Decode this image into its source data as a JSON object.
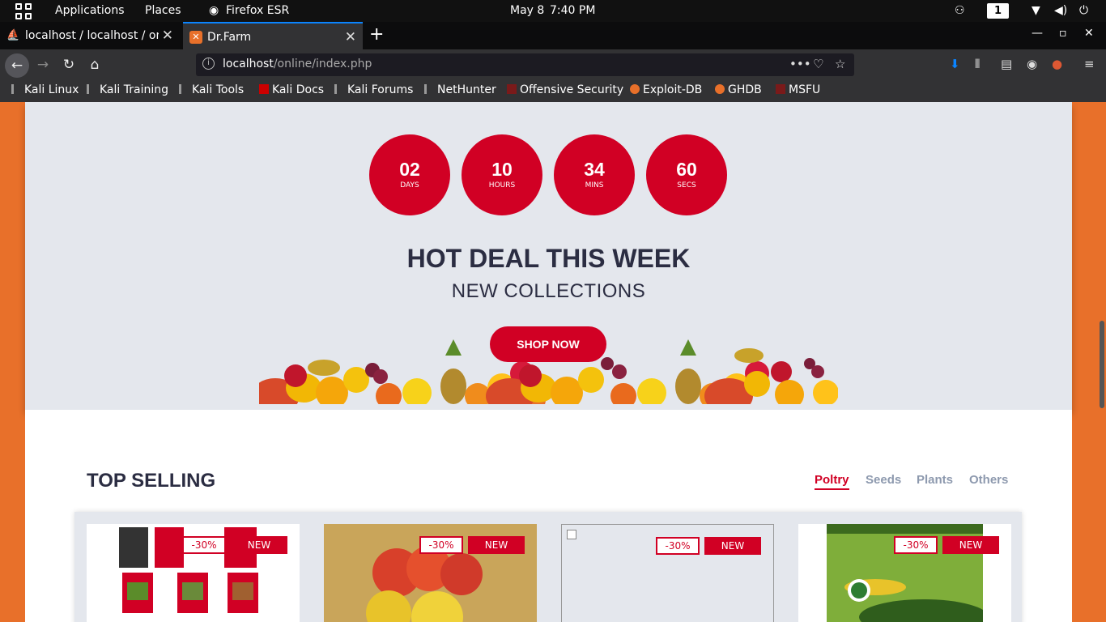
{
  "system_bar": {
    "applications": "Applications",
    "places": "Places",
    "browser": "Firefox ESR",
    "date": "May 8",
    "time": "7:40 PM",
    "workspace": "1"
  },
  "tabs": [
    {
      "label": "localhost / localhost / onli",
      "active": false
    },
    {
      "label": "Dr.Farm",
      "active": true
    }
  ],
  "url": {
    "host": "localhost",
    "path": "/online/index.php"
  },
  "bookmarks": [
    "Kali Linux",
    "Kali Training",
    "Kali Tools",
    "Kali Docs",
    "Kali Forums",
    "NetHunter",
    "Offensive Security",
    "Exploit-DB",
    "GHDB",
    "MSFU"
  ],
  "countdown": [
    {
      "value": "02",
      "unit": "Days"
    },
    {
      "value": "10",
      "unit": "Hours"
    },
    {
      "value": "34",
      "unit": "Mins"
    },
    {
      "value": "60",
      "unit": "Secs"
    }
  ],
  "deal": {
    "title": "HOT DEAL THIS WEEK",
    "subtitle": "NEW COLLECTIONS",
    "button": "SHOP NOW"
  },
  "top_selling": {
    "title": "TOP SELLING",
    "tabs": [
      "Poltry",
      "Seeds",
      "Plants",
      "Others"
    ],
    "active_tab": "Poltry",
    "products": [
      {
        "discount": "-30%",
        "label": "NEW"
      },
      {
        "discount": "-30%",
        "label": "NEW"
      },
      {
        "discount": "-30%",
        "label": "NEW"
      },
      {
        "discount": "-30%",
        "label": "NEW"
      }
    ]
  },
  "colors": {
    "accent": "#d10024",
    "page_bg": "#e8702a",
    "section_bg": "#e4e7ed",
    "text_dark": "#2b2d42"
  }
}
